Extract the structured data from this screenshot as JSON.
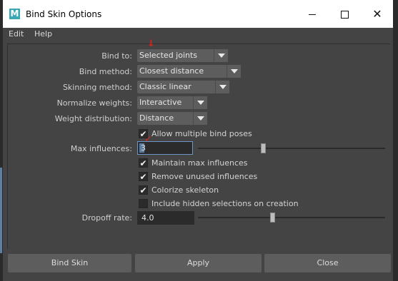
{
  "window": {
    "title": "Bind Skin Options",
    "icon_letter": "M",
    "close_glyph": "✕"
  },
  "menu": {
    "items": [
      "Edit",
      "Help"
    ]
  },
  "bind_to": {
    "label": "Bind to:",
    "value": "Selected joints"
  },
  "bind_method": {
    "label": "Bind method:",
    "value": "Closest distance"
  },
  "skinning_method": {
    "label": "Skinning method:",
    "value": "Classic linear"
  },
  "normalize_weights": {
    "label": "Normalize weights:",
    "value": "Interactive"
  },
  "weight_distribution": {
    "label": "Weight distribution:",
    "value": "Distance"
  },
  "checkboxes": {
    "allow_multiple": {
      "label": "Allow multiple bind poses",
      "checked": true
    },
    "maintain_max": {
      "label": "Maintain max influences",
      "checked": true
    },
    "remove_unused": {
      "label": "Remove unused influences",
      "checked": true
    },
    "colorize": {
      "label": "Colorize skeleton",
      "checked": true
    },
    "include_hidden": {
      "label": "Include hidden selections on creation",
      "checked": false
    }
  },
  "check_glyph": "✔",
  "max_influences": {
    "label": "Max influences:",
    "value": "3",
    "slider_fraction": 0.35
  },
  "dropoff_rate": {
    "label": "Dropoff rate:",
    "value": "4.0",
    "slider_fraction": 0.4
  },
  "buttons": {
    "bind_skin": "Bind Skin",
    "apply": "Apply",
    "close": "Close"
  },
  "colors": {
    "accent": "#5d7fa3",
    "annotation": "#e02020"
  }
}
